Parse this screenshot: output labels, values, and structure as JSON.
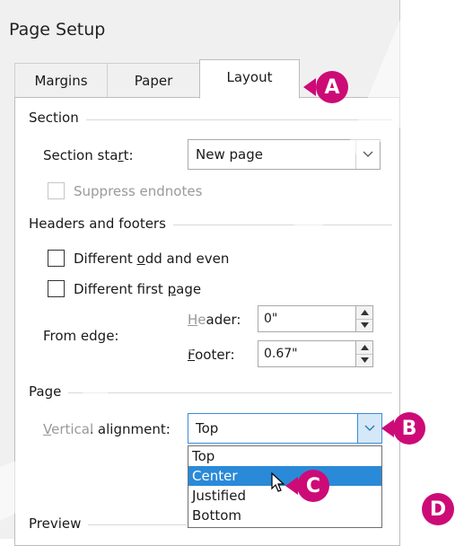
{
  "dialog": {
    "title": "Page Setup"
  },
  "tabs": [
    {
      "label": "Margins"
    },
    {
      "label": "Paper"
    },
    {
      "label": "Layout"
    }
  ],
  "section": {
    "heading": "Section",
    "start_label": "Section start:",
    "start_value": "New page",
    "suppress_label": "Suppress endnotes"
  },
  "headers_footers": {
    "heading": "Headers and footers",
    "odd_even_label": "Different odd and even",
    "first_page_label": "Different first page",
    "from_edge_label": "From edge:",
    "header_label": "Header:",
    "header_value": "0\"",
    "footer_label": "Footer:",
    "footer_value": "0.67\""
  },
  "page": {
    "heading": "Page",
    "vertical_alignment_label": "Vertical alignment:",
    "vertical_alignment_value": "Top",
    "options": [
      "Top",
      "Center",
      "Justified",
      "Bottom"
    ]
  },
  "preview": {
    "heading": "Preview"
  },
  "callouts": {
    "a": "A",
    "b": "B",
    "c": "C",
    "d": "D"
  },
  "colors": {
    "callout": "#cc0b77",
    "selection": "#2a8ad8"
  }
}
